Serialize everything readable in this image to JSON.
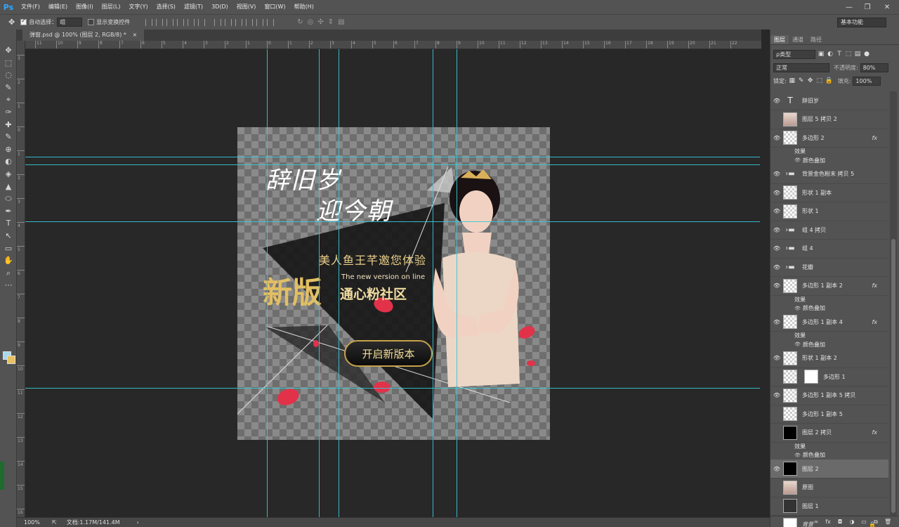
{
  "app": {
    "logo": "Ps"
  },
  "menu": [
    "文件(F)",
    "编辑(E)",
    "图像(I)",
    "图层(L)",
    "文字(Y)",
    "选择(S)",
    "滤镜(T)",
    "3D(D)",
    "视图(V)",
    "窗口(W)",
    "帮助(H)"
  ],
  "window_controls": {
    "minimize": "—",
    "restore": "❐",
    "close": "✕"
  },
  "options": {
    "auto_select_label": "自动选择：",
    "auto_select_value": "组",
    "show_transform_label": "显示变换控件",
    "workspace": "基本功能"
  },
  "document": {
    "tab_title": "弹窗.psd @ 100% (图层 2, RGB/8) *",
    "close": "×"
  },
  "tools": [
    "✥",
    "⬚",
    "◌",
    "✎",
    "⌖",
    "✑",
    "✚",
    "✎",
    "⊕",
    "◐",
    "◈",
    "▲",
    "⬭",
    "✒",
    "T",
    "↖",
    "▭",
    "✋",
    "⌕",
    "⋯"
  ],
  "rulers": {
    "top": [
      "11",
      "10",
      "9",
      "8",
      "7",
      "6",
      "5",
      "4",
      "3",
      "2",
      "1",
      "0",
      "1",
      "2",
      "3",
      "4",
      "5",
      "6",
      "7",
      "8",
      "9",
      "10",
      "11",
      "12",
      "13",
      "14",
      "15",
      "16",
      "17",
      "18",
      "19",
      "20",
      "21",
      "22"
    ],
    "left": [
      "3",
      "2",
      "1",
      "0",
      "1",
      "2",
      "3",
      "4",
      "5",
      "6",
      "7",
      "8",
      "9",
      "10",
      "11",
      "12",
      "13",
      "14",
      "15",
      "16"
    ]
  },
  "banner": {
    "title_line1": "辞旧岁",
    "title_line2": "迎今朝",
    "subtitle": "美人鱼王芊邀您体验",
    "english": "The new version on line",
    "big_text": "新版",
    "community": "通心粉社区",
    "button": "开启新版本"
  },
  "status": {
    "zoom": "100%",
    "doc_info": "文档:1.17M/141.4M",
    "arrow": "›"
  },
  "panel": {
    "tabs": [
      "图层",
      "通道",
      "路径"
    ],
    "kind_label": "ρ类型",
    "blend_mode": "正常",
    "opacity_label": "不透明度:",
    "opacity_value": "80%",
    "lock_label": "锁定:",
    "fill_label": "填充:",
    "fill_value": "100%",
    "layers": [
      {
        "name": "辞旧岁",
        "type": "text"
      },
      {
        "name": "图层 5 拷贝 2",
        "type": "photo"
      },
      {
        "name": "多边形 2",
        "type": "shape",
        "fx": "fx"
      },
      {
        "name": "效果",
        "type": "effect-header"
      },
      {
        "name": "颜色叠加",
        "type": "effect"
      },
      {
        "name": "背景金色粉末 拷贝 5",
        "type": "folder"
      },
      {
        "name": "形状 1 副本",
        "type": "shape"
      },
      {
        "name": "形状 1",
        "type": "shape"
      },
      {
        "name": "组 4 拷贝",
        "type": "folder"
      },
      {
        "name": "组 4",
        "type": "folder"
      },
      {
        "name": "花瓣",
        "type": "folder"
      },
      {
        "name": "多边形 1 副本 2",
        "type": "shape",
        "fx": "fx"
      },
      {
        "name": "效果",
        "type": "effect-header"
      },
      {
        "name": "颜色叠加",
        "type": "effect"
      },
      {
        "name": "多边形 1 副本 4",
        "type": "shape",
        "fx": "fx"
      },
      {
        "name": "效果",
        "type": "effect-header"
      },
      {
        "name": "颜色叠加",
        "type": "effect"
      },
      {
        "name": "形状 1 副本 2",
        "type": "shape"
      },
      {
        "name": "多边形 1",
        "type": "masked"
      },
      {
        "name": "多边形 1 副本 5 拷贝",
        "type": "shape"
      },
      {
        "name": "多边形 1 副本 5",
        "type": "shape"
      },
      {
        "name": "图层 2 拷贝",
        "type": "black",
        "fx": "fx"
      },
      {
        "name": "效果",
        "type": "effect-header"
      },
      {
        "name": "颜色叠加",
        "type": "effect"
      },
      {
        "name": "图层 2",
        "type": "black"
      },
      {
        "name": "原图",
        "type": "photo"
      },
      {
        "name": "图层 1",
        "type": "dark"
      },
      {
        "name": "背景",
        "type": "white"
      }
    ],
    "bottom_icons": [
      "∞",
      "fx",
      "◘",
      "◑",
      "▭",
      "⧉",
      "🗑"
    ]
  },
  "colors": {
    "guide": "#38c8d8",
    "gold": "#e2bf63",
    "panel_bg": "#535353"
  }
}
